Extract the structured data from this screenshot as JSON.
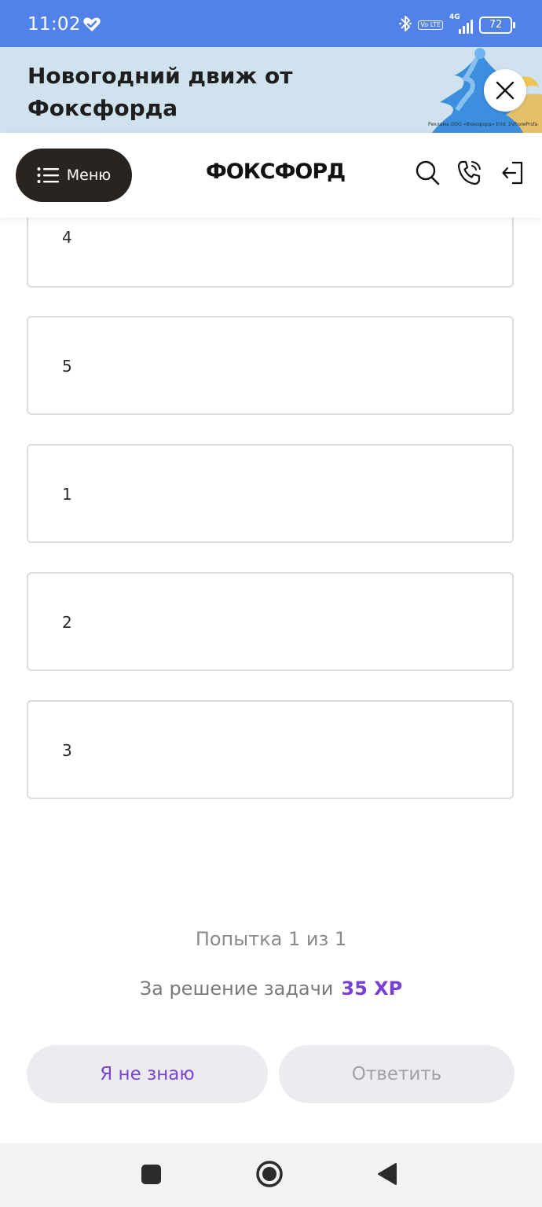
{
  "status_bar": {
    "time": "11:02",
    "volte": "Vo LTE",
    "network": "4G",
    "battery": "72"
  },
  "promo": {
    "title": "Новогодний движ от Фоксфорда",
    "legal": "Реклама ООО «Фоксфорд» Erid: 2VfnxwPrsfa"
  },
  "header": {
    "menu_label": "Меню",
    "logo": "ФОКСФОРД"
  },
  "options": [
    {
      "label": "4"
    },
    {
      "label": "5"
    },
    {
      "label": "1"
    },
    {
      "label": "2"
    },
    {
      "label": "3"
    }
  ],
  "footer": {
    "attempt": "Попытка 1 из 1",
    "reward_label": "За решение задачи",
    "reward_xp": "35 XP",
    "dont_know": "Я не знаю",
    "answer": "Ответить"
  },
  "colors": {
    "status_bar": "#5281e8",
    "promo_bg": "#cfe2ee",
    "menu_button": "#2a2420",
    "accent": "#7a3fd1"
  },
  "icons": [
    "heart-check-icon",
    "bluetooth-icon",
    "signal-icon",
    "battery-icon",
    "close-icon",
    "menu-icon",
    "search-icon",
    "phone-icon",
    "login-icon",
    "recent-apps-icon",
    "home-icon",
    "back-icon"
  ]
}
